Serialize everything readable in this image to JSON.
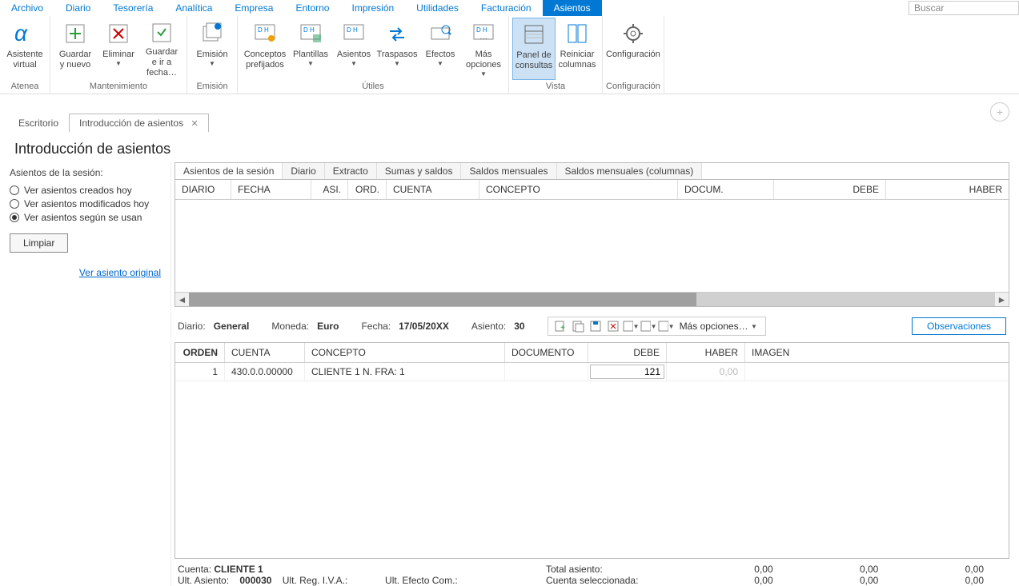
{
  "search_placeholder": "Buscar",
  "menu": [
    "Archivo",
    "Diario",
    "Tesorería",
    "Analítica",
    "Empresa",
    "Entorno",
    "Impresión",
    "Utilidades",
    "Facturación",
    "Asientos"
  ],
  "menu_active": 9,
  "ribbon": {
    "atenea": {
      "label": "Atenea",
      "asistente": "Asistente virtual"
    },
    "mantenimiento": {
      "label": "Mantenimiento",
      "guardar_nuevo": "Guardar y nuevo",
      "eliminar": "Eliminar",
      "guardar_fecha": "Guardar e ir a fecha…"
    },
    "emision_grp": {
      "label": "Emisión",
      "emision": "Emisión"
    },
    "utiles": {
      "label": "Útiles",
      "conceptos": "Conceptos prefijados",
      "plantillas": "Plantillas",
      "asientos": "Asientos",
      "traspasos": "Traspasos",
      "efectos": "Efectos",
      "mas": "Más opciones"
    },
    "vista": {
      "label": "Vista",
      "panel": "Panel de consultas",
      "reiniciar": "Reiniciar columnas"
    },
    "config_grp": {
      "label": "Configuración",
      "config": "Configuración"
    }
  },
  "workspace_tabs": {
    "escritorio": "Escritorio",
    "intro": "Introducción de asientos"
  },
  "circle_plus": "+",
  "page_title": "Introducción de asientos",
  "side": {
    "title": "Asientos de la sesión:",
    "r1": "Ver asientos creados hoy",
    "r2": "Ver asientos modificados hoy",
    "r3": "Ver asientos según se usan",
    "limpiar": "Limpiar",
    "link": "Ver asiento original"
  },
  "view_tabs": [
    "Asientos de la sesión",
    "Diario",
    "Extracto",
    "Sumas y saldos",
    "Saldos mensuales",
    "Saldos mensuales (columnas)"
  ],
  "upper_cols": [
    "DIARIO",
    "FECHA",
    "ASI.",
    "ORD.",
    "CUENTA",
    "CONCEPTO",
    "DOCUM.",
    "DEBE",
    "HABER"
  ],
  "entry": {
    "diario_lbl": "Diario:",
    "diario_val": "General",
    "moneda_lbl": "Moneda:",
    "moneda_val": "Euro",
    "fecha_lbl": "Fecha:",
    "fecha_val": "17/05/20XX",
    "asiento_lbl": "Asiento:",
    "asiento_val": "30",
    "mas_opciones": "Más opciones…",
    "observaciones": "Observaciones"
  },
  "lower_cols": [
    "ORDEN",
    "CUENTA",
    "CONCEPTO",
    "DOCUMENTO",
    "DEBE",
    "HABER",
    "IMAGEN"
  ],
  "lower_row": {
    "orden": "1",
    "cuenta": "430.0.0.00000",
    "concepto": "CLIENTE 1 N. FRA:  1",
    "documento": "",
    "debe": "121",
    "haber": "0,00",
    "imagen": ""
  },
  "footer": {
    "cuenta_lbl": "Cuenta:",
    "cuenta_val": "CLIENTE 1",
    "ult_asiento_lbl": "Ult. Asiento:",
    "ult_asiento_val": "000030",
    "ult_reg": "Ult. Reg. I.V.A.:",
    "ult_efecto": "Ult. Efecto Com.:",
    "total_asiento": "Total asiento:",
    "cuenta_sel": "Cuenta seleccionada:",
    "v00": "0,00"
  }
}
